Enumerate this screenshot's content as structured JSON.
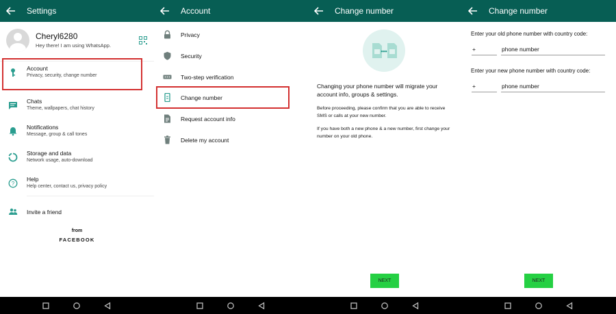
{
  "colors": {
    "header": "#075e54",
    "accent": "#2a9d8f",
    "icon_gray": "#6f7f7c",
    "highlight_box": "#d32f2f",
    "next_button": "#25d043"
  },
  "settings": {
    "title": "Settings",
    "profile": {
      "name": "Cheryl6280",
      "status": "Hey there! I am using WhatsApp."
    },
    "items": [
      {
        "label": "Account",
        "sub": "Privacy, security, change number",
        "icon": "key-icon"
      },
      {
        "label": "Chats",
        "sub": "Theme, wallpapers, chat history",
        "icon": "chat-icon"
      },
      {
        "label": "Notifications",
        "sub": "Message, group & call tones",
        "icon": "bell-icon"
      },
      {
        "label": "Storage and data",
        "sub": "Network usage, auto-download",
        "icon": "storage-icon"
      },
      {
        "label": "Help",
        "sub": "Help center, contact us, privacy policy",
        "icon": "help-icon"
      }
    ],
    "invite": {
      "label": "Invite a friend",
      "icon": "people-icon"
    },
    "footer": {
      "from": "from",
      "brand": "FACEBOOK"
    }
  },
  "account": {
    "title": "Account",
    "items": [
      {
        "label": "Privacy",
        "icon": "lock-icon"
      },
      {
        "label": "Security",
        "icon": "shield-icon"
      },
      {
        "label": "Two-step verification",
        "icon": "dots-icon"
      },
      {
        "label": "Change number",
        "icon": "phone-change-icon"
      },
      {
        "label": "Request account info",
        "icon": "document-icon"
      },
      {
        "label": "Delete my account",
        "icon": "trash-icon"
      }
    ]
  },
  "change_intro": {
    "title": "Change number",
    "para1": "Changing your phone number will migrate your account info, groups & settings.",
    "para2": "Before proceeding, please confirm that you are able to receive SMS or calls at your new number.",
    "para3": "If you have both a new phone & a new number, first change your number on your old phone.",
    "next": "NEXT"
  },
  "change_form": {
    "title": "Change number",
    "old_prompt": "Enter your old phone number with country code:",
    "new_prompt": "Enter your new phone number with country code:",
    "country_code_prefix": "+",
    "phone_placeholder": "phone number",
    "next": "NEXT"
  }
}
